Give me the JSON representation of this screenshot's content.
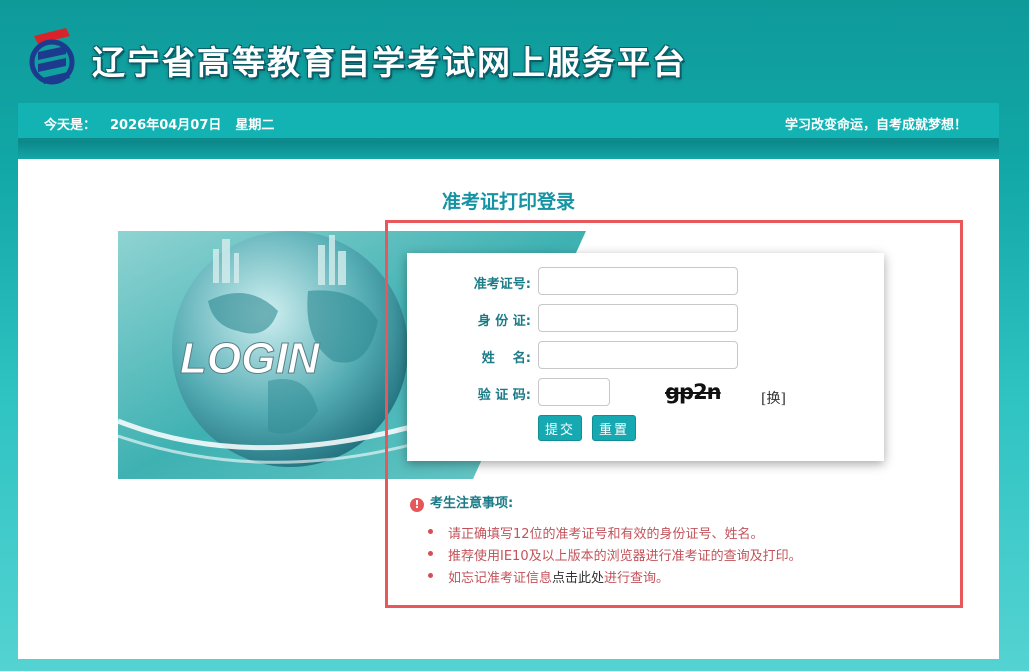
{
  "header": {
    "site_title": "辽宁省高等教育自学考试网上服务平台"
  },
  "infobar": {
    "date_prefix": "今天是：",
    "date": "2026年04月07日",
    "weekday": "星期二",
    "motto": "学习改变命运，自考成就梦想！"
  },
  "main": {
    "title": "准考证打印登录",
    "banner_text": "LOGIN",
    "form": {
      "exam_id_label": "准考证号:",
      "id_card_label": "身 份 证:",
      "name_label": "姓    名:",
      "captcha_label": "验 证 码:",
      "captcha_text": "gp2n",
      "refresh_label": "[换]",
      "submit_label": "提交",
      "reset_label": "重置"
    },
    "notice": {
      "icon": "!",
      "title": "考生注意事项:",
      "items": [
        "请正确填写12位的准考证号和有效的身份证号、姓名。",
        "推荐使用IE10及以上版本的浏览器进行准考证的查询及打印。"
      ],
      "forgot_prefix": "如忘记准考证信息",
      "forgot_link": "点击此处",
      "forgot_suffix": "进行查询。"
    }
  },
  "colors": {
    "accent": "#13b3b3",
    "title": "#1593a3",
    "notice_text": "#c2535a",
    "highlight_border": "#e9575b"
  }
}
